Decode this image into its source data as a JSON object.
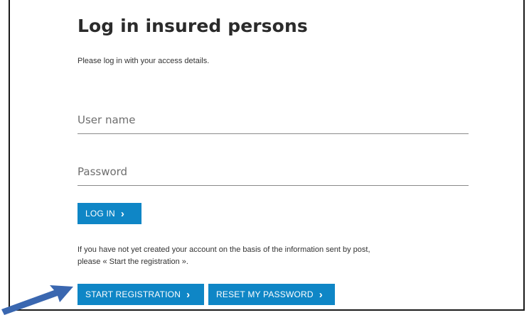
{
  "page": {
    "title": "Log in insured persons",
    "subtitle": "Please log in with your access details."
  },
  "form": {
    "username_placeholder": "User name",
    "username_value": "",
    "password_placeholder": "Password",
    "password_value": "",
    "login_label": "LOG IN"
  },
  "registration": {
    "info_line1": "If you have not yet created your account on the basis of the information sent by post,",
    "info_line2": "please « Start the registration ».",
    "start_label": "START REGISTRATION",
    "reset_label": "RESET MY PASSWORD"
  },
  "icons": {
    "chevron": "chevron-right-icon",
    "annotation_arrow": "arrow-icon"
  },
  "colors": {
    "button_blue": "#0f86c6",
    "annotation_arrow": "#3a67b0",
    "frame_border": "#1a1a1a"
  }
}
